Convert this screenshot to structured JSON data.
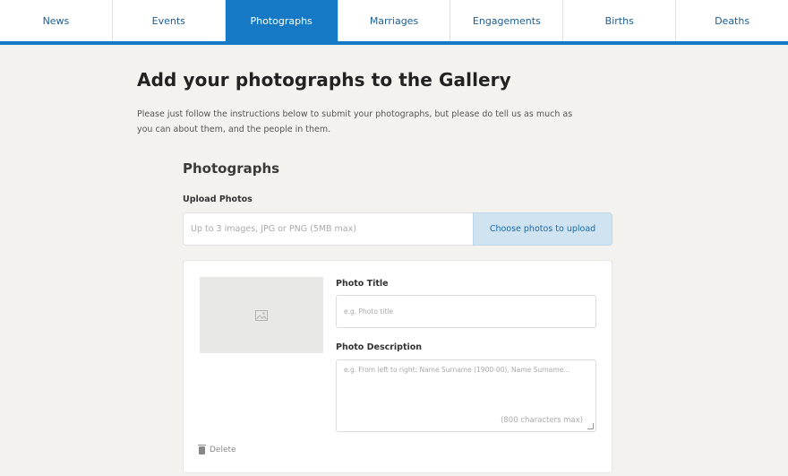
{
  "tabs": [
    {
      "label": "News",
      "active": false
    },
    {
      "label": "Events",
      "active": false
    },
    {
      "label": "Photographs",
      "active": true
    },
    {
      "label": "Marriages",
      "active": false
    },
    {
      "label": "Engagements",
      "active": false
    },
    {
      "label": "Births",
      "active": false
    },
    {
      "label": "Deaths",
      "active": false
    }
  ],
  "page": {
    "title": "Add your photographs to the Gallery",
    "intro": "Please just follow the instructions below to submit your photographs, but please do tell us as much as you can about them, and the people in them."
  },
  "photographs": {
    "section_title": "Photographs",
    "upload_label": "Upload Photos",
    "upload_placeholder": "Up to 3 images, JPG or PNG (5MB max)",
    "upload_button": "Choose photos to upload"
  },
  "photo_card": {
    "thumbnail_icon": "image-placeholder-icon",
    "title_label": "Photo Title",
    "title_placeholder": "e.g. Photo title",
    "description_label": "Photo Description",
    "description_placeholder": "e.g. From left to right: Name Surname (1900-00), Name Surname...",
    "description_counter": "(800 characters max)",
    "delete_label": "Delete",
    "delete_icon": "trash-icon"
  },
  "colors": {
    "accent": "#1679c5",
    "upload_button_bg": "#cfe3f1",
    "background": "#f3f2ee"
  }
}
